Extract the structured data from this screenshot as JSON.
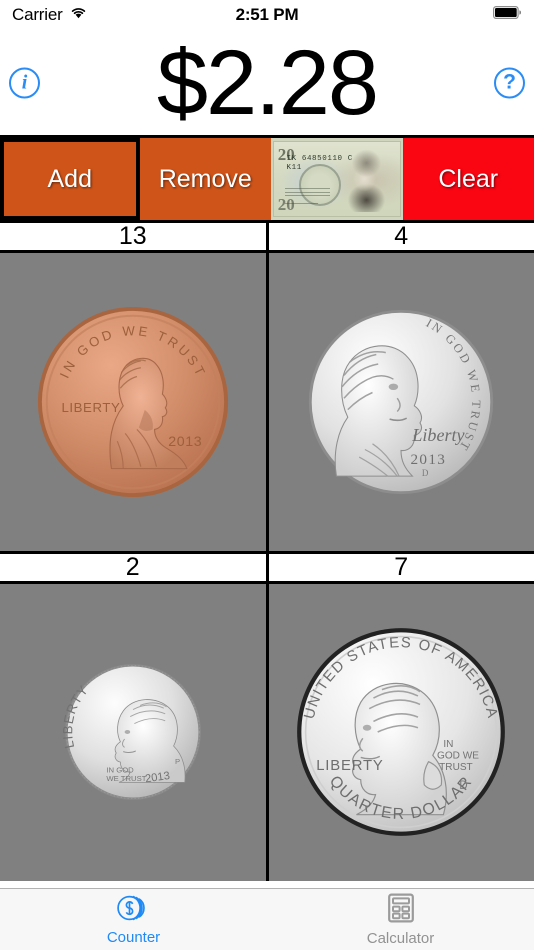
{
  "status_bar": {
    "carrier": "Carrier",
    "wifi_icon": "wifi-icon",
    "time": "2:51 PM",
    "battery_icon": "battery-full-icon"
  },
  "header": {
    "total": "$2.28",
    "info_button": {
      "icon": "info-circle-icon",
      "label": "i"
    },
    "help_button": {
      "icon": "question-circle-icon",
      "label": "?"
    }
  },
  "actions": [
    {
      "id": "add",
      "label": "Add",
      "selected": true,
      "color": "#cf5419"
    },
    {
      "id": "remove",
      "label": "Remove",
      "selected": false,
      "color": "#cf5419"
    },
    {
      "id": "bill",
      "label": "",
      "selected": false,
      "color": "#cdd3b9",
      "icon": "twenty-dollar-bill-icon",
      "bill": {
        "denomination": "20",
        "serial": "IK 64850110 C",
        "plate": "K11"
      }
    },
    {
      "id": "clear",
      "label": "Clear",
      "selected": false,
      "color": "#fa0512"
    }
  ],
  "coins": [
    {
      "id": "penny",
      "name": "penny",
      "count": "13",
      "value_cents": 1,
      "year": "2013",
      "mintmark": "",
      "motto": "IN GOD WE TRUST",
      "liberty": "LIBERTY",
      "portrait": "Lincoln",
      "metal": "#c7805f",
      "icon": "penny-coin-icon"
    },
    {
      "id": "nickel",
      "name": "nickel",
      "count": "4",
      "value_cents": 5,
      "year": "2013",
      "mintmark": "D",
      "motto": "IN GOD WE TRUST",
      "liberty": "Liberty",
      "portrait": "Jefferson",
      "metal": "#e9e9e9",
      "icon": "nickel-coin-icon"
    },
    {
      "id": "dime",
      "name": "dime",
      "count": "2",
      "value_cents": 10,
      "year": "2013",
      "mintmark": "P",
      "motto": "IN GOD WE TRUST",
      "liberty": "LIBERTY",
      "portrait": "Roosevelt",
      "metal": "#e9e9e9",
      "icon": "dime-coin-icon"
    },
    {
      "id": "quarter",
      "name": "quarter",
      "count": "7",
      "value_cents": 25,
      "year": "",
      "mintmark": "D",
      "motto": "IN GOD WE TRUST",
      "liberty": "LIBERTY",
      "country": "UNITED STATES OF AMERICA",
      "denomination_text": "QUARTER DOLLAR",
      "portrait": "Washington",
      "metal": "#e9e9e9",
      "icon": "quarter-coin-icon"
    }
  ],
  "tabs": [
    {
      "id": "counter",
      "label": "Counter",
      "icon": "coins-stack-icon",
      "active": true,
      "color": "#1f8af5"
    },
    {
      "id": "calculator",
      "label": "Calculator",
      "icon": "calculator-icon",
      "active": false,
      "color": "#929292"
    }
  ]
}
